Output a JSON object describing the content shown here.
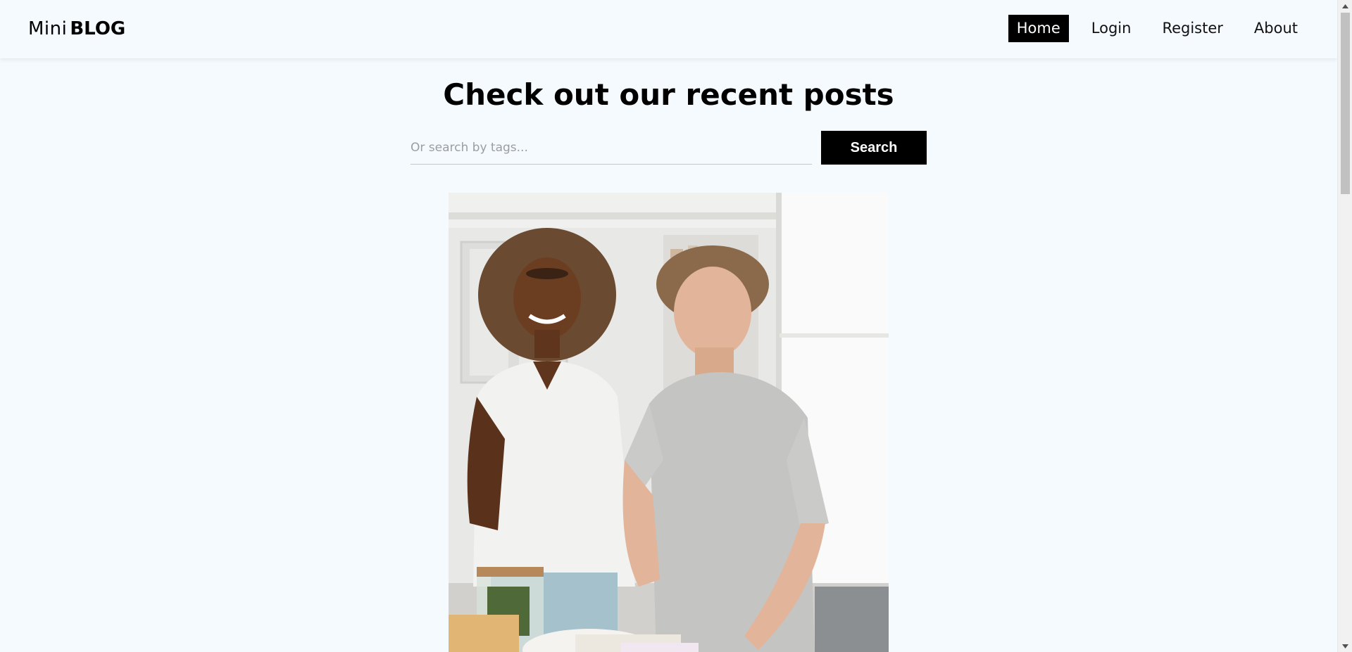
{
  "brand": {
    "light": "Mini",
    "bold": "BLOG"
  },
  "nav": {
    "items": [
      {
        "label": "Home",
        "active": true
      },
      {
        "label": "Login",
        "active": false
      },
      {
        "label": "Register",
        "active": false
      },
      {
        "label": "About",
        "active": false
      }
    ]
  },
  "main": {
    "title": "Check out our recent posts",
    "search": {
      "placeholder": "Or search by tags...",
      "value": "",
      "button_label": "Search"
    }
  },
  "post": {
    "image_icon": "post-photo"
  },
  "colors": {
    "background": "#f5faff",
    "accent": "#000000",
    "nav_active_text": "#ffffff"
  }
}
